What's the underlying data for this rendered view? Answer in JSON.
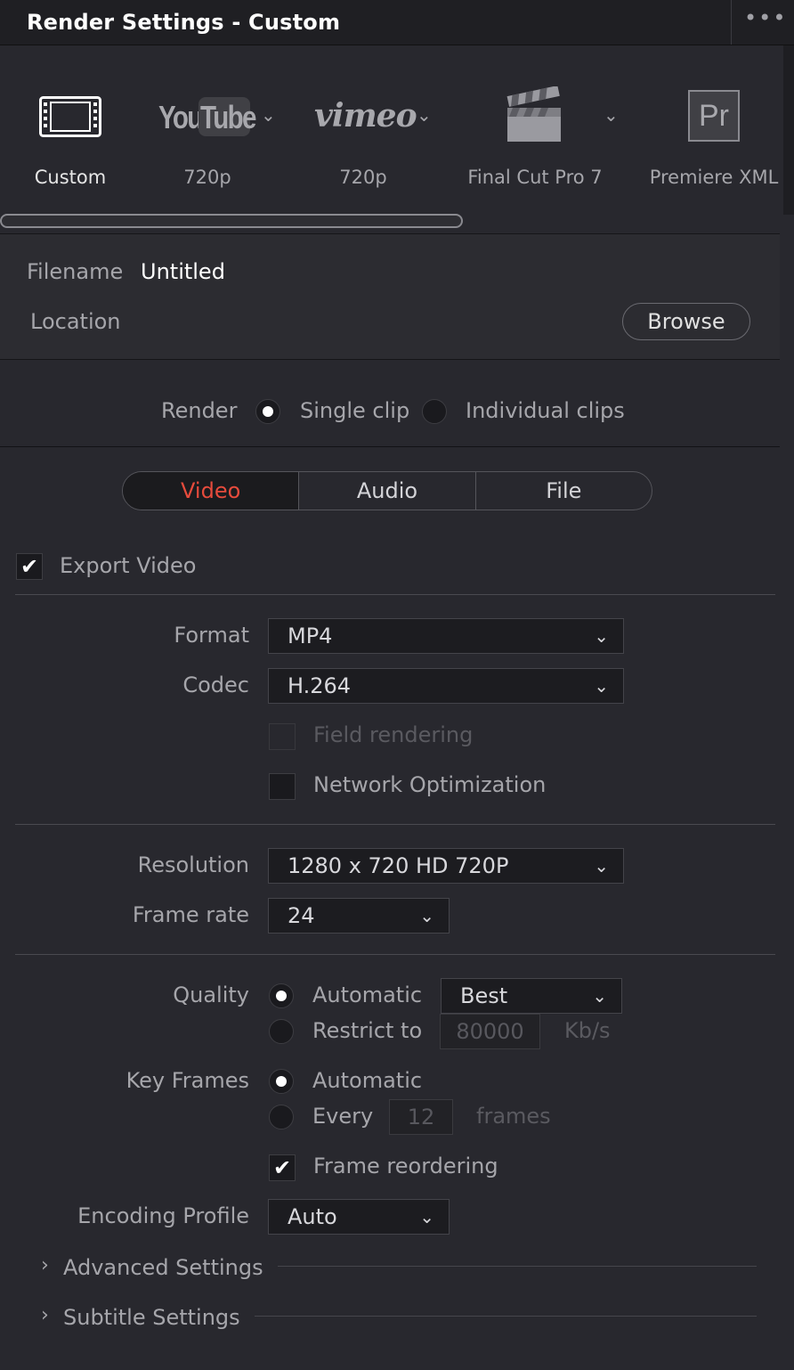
{
  "window": {
    "title": "Render Settings - Custom",
    "menu_icon": "more-dots-icon"
  },
  "presets": [
    {
      "label": "Custom",
      "icon": "film-strip-icon",
      "active": true
    },
    {
      "label": "720p",
      "icon": "youtube-logo",
      "logo_text": "YouTube",
      "has_dropdown": true
    },
    {
      "label": "720p",
      "icon": "vimeo-logo",
      "logo_text": "vimeo",
      "has_dropdown": true
    },
    {
      "label": "Final Cut Pro 7",
      "icon": "clapperboard-icon",
      "has_dropdown": true
    },
    {
      "label": "Premiere XML",
      "icon": "premiere-icon",
      "logo_text": "Pr"
    }
  ],
  "file": {
    "filename_label": "Filename",
    "filename_value": "Untitled",
    "location_label": "Location",
    "browse_label": "Browse"
  },
  "render": {
    "label": "Render",
    "options": [
      "Single clip",
      "Individual clips"
    ],
    "selected": "Single clip"
  },
  "tabs": [
    "Video",
    "Audio",
    "File"
  ],
  "active_tab": "Video",
  "accent_color": "#e64b3c",
  "video": {
    "export_label": "Export Video",
    "export_checked": true,
    "format_label": "Format",
    "format_value": "MP4",
    "codec_label": "Codec",
    "codec_value": "H.264",
    "field_rendering_label": "Field rendering",
    "network_opt_label": "Network Optimization",
    "resolution_label": "Resolution",
    "resolution_value": "1280 x 720 HD 720P",
    "framerate_label": "Frame rate",
    "framerate_value": "24",
    "quality_label": "Quality",
    "quality_auto_label": "Automatic",
    "quality_auto_value": "Best",
    "quality_restrict_label": "Restrict to",
    "quality_restrict_value": "80000",
    "quality_unit": "Kb/s",
    "keyframes_label": "Key Frames",
    "keyframes_auto_label": "Automatic",
    "keyframes_every_label": "Every",
    "keyframes_every_value": "12",
    "keyframes_unit": "frames",
    "frame_reorder_label": "Frame reordering",
    "frame_reorder_checked": true,
    "encoding_profile_label": "Encoding Profile",
    "encoding_profile_value": "Auto",
    "advanced_label": "Advanced Settings",
    "subtitle_label": "Subtitle Settings"
  }
}
